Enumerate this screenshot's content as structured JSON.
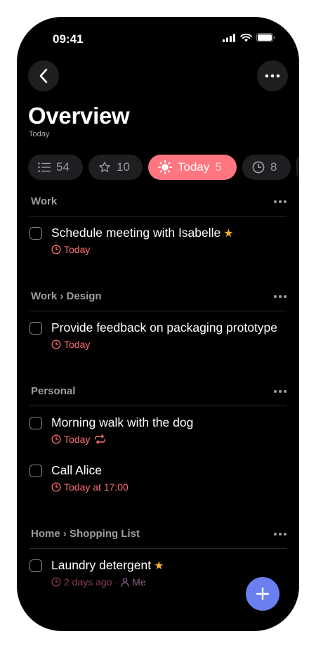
{
  "status_bar": {
    "time": "09:41"
  },
  "header": {
    "title": "Overview",
    "subtitle": "Today"
  },
  "chips": [
    {
      "icon": "list-icon",
      "count": "54",
      "active": false
    },
    {
      "icon": "star-outline-icon",
      "count": "10",
      "active": false
    },
    {
      "icon": "sun-icon",
      "label": "Today",
      "count": "5",
      "active": true
    },
    {
      "icon": "clock-icon",
      "count": "8",
      "active": false
    }
  ],
  "sections": [
    {
      "title": "Work",
      "tasks": [
        {
          "title": "Schedule meeting with Isabelle",
          "starred": true,
          "due": "Today"
        }
      ]
    },
    {
      "title": "Work › Design",
      "tasks": [
        {
          "title": "Provide feedback on packaging prototype",
          "starred": false,
          "due": "Today"
        }
      ]
    },
    {
      "title": "Personal",
      "tasks": [
        {
          "title": "Morning walk with the dog",
          "starred": false,
          "due": "Today",
          "repeat": true
        },
        {
          "title": "Call Alice",
          "starred": false,
          "due": "Today at 17:00"
        }
      ]
    },
    {
      "title": "Home › Shopping List",
      "tasks": [
        {
          "title": "Laundry detergent",
          "starred": true,
          "due": "2 days ago",
          "separator": "·",
          "assignee": "Me"
        }
      ]
    }
  ],
  "colors": {
    "accent": "#ff7580",
    "due": "#ff6f6f",
    "star": "#f5b323",
    "fab": "#6b80f0",
    "background": "#000000"
  }
}
